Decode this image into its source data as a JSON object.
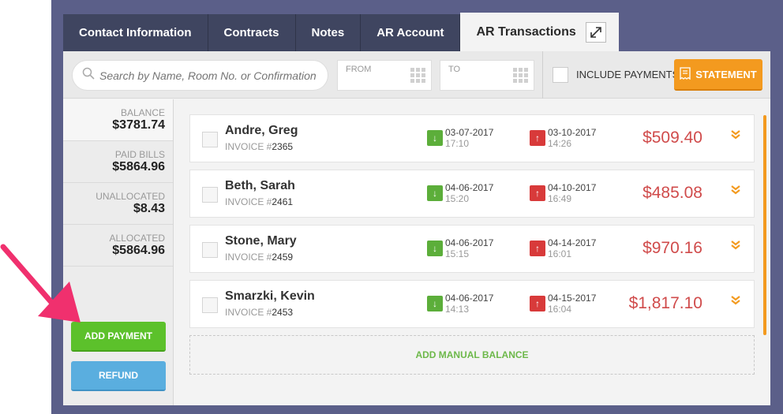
{
  "tabs": [
    {
      "label": "Contact Information"
    },
    {
      "label": "Contracts"
    },
    {
      "label": "Notes"
    },
    {
      "label": "AR Account"
    },
    {
      "label": "AR Transactions"
    }
  ],
  "search": {
    "placeholder": "Search by Name, Room No. or Confirmation"
  },
  "filters": {
    "from_label": "FROM",
    "to_label": "TO",
    "include_payments": "INCLUDE PAYMENTS",
    "statement": "STATEMENT"
  },
  "summary": [
    {
      "key": "BALANCE",
      "value": "$3781.74"
    },
    {
      "key": "PAID BILLS",
      "value": "$5864.96"
    },
    {
      "key": "UNALLOCATED",
      "value": "$8.43"
    },
    {
      "key": "ALLOCATED",
      "value": "$5864.96"
    }
  ],
  "actions": {
    "add_payment": "ADD PAYMENT",
    "refund": "REFUND"
  },
  "invoice_prefix": "INVOICE #",
  "transactions": [
    {
      "name": "Andre, Greg",
      "invoice": "2365",
      "date_in": "03-07-2017",
      "time_in": "17:10",
      "date_out": "03-10-2017",
      "time_out": "14:26",
      "amount": "$509.40"
    },
    {
      "name": "Beth, Sarah",
      "invoice": "2461",
      "date_in": "04-06-2017",
      "time_in": "15:20",
      "date_out": "04-10-2017",
      "time_out": "16:49",
      "amount": "$485.08"
    },
    {
      "name": "Stone, Mary",
      "invoice": "2459",
      "date_in": "04-06-2017",
      "time_in": "15:15",
      "date_out": "04-14-2017",
      "time_out": "16:01",
      "amount": "$970.16"
    },
    {
      "name": "Smarzki, Kevin",
      "invoice": "2453",
      "date_in": "04-06-2017",
      "time_in": "14:13",
      "date_out": "04-15-2017",
      "time_out": "16:04",
      "amount": "$1,817.10"
    }
  ],
  "add_manual_balance": "ADD MANUAL BALANCE",
  "colors": {
    "frame": "#5b5f89",
    "tab_dark": "#3f4560",
    "orange": "#f39a1f",
    "green": "#5cc12b",
    "blue": "#5aaedf",
    "amount_red": "#d04b4b",
    "pointer_pink": "#f0306e"
  }
}
